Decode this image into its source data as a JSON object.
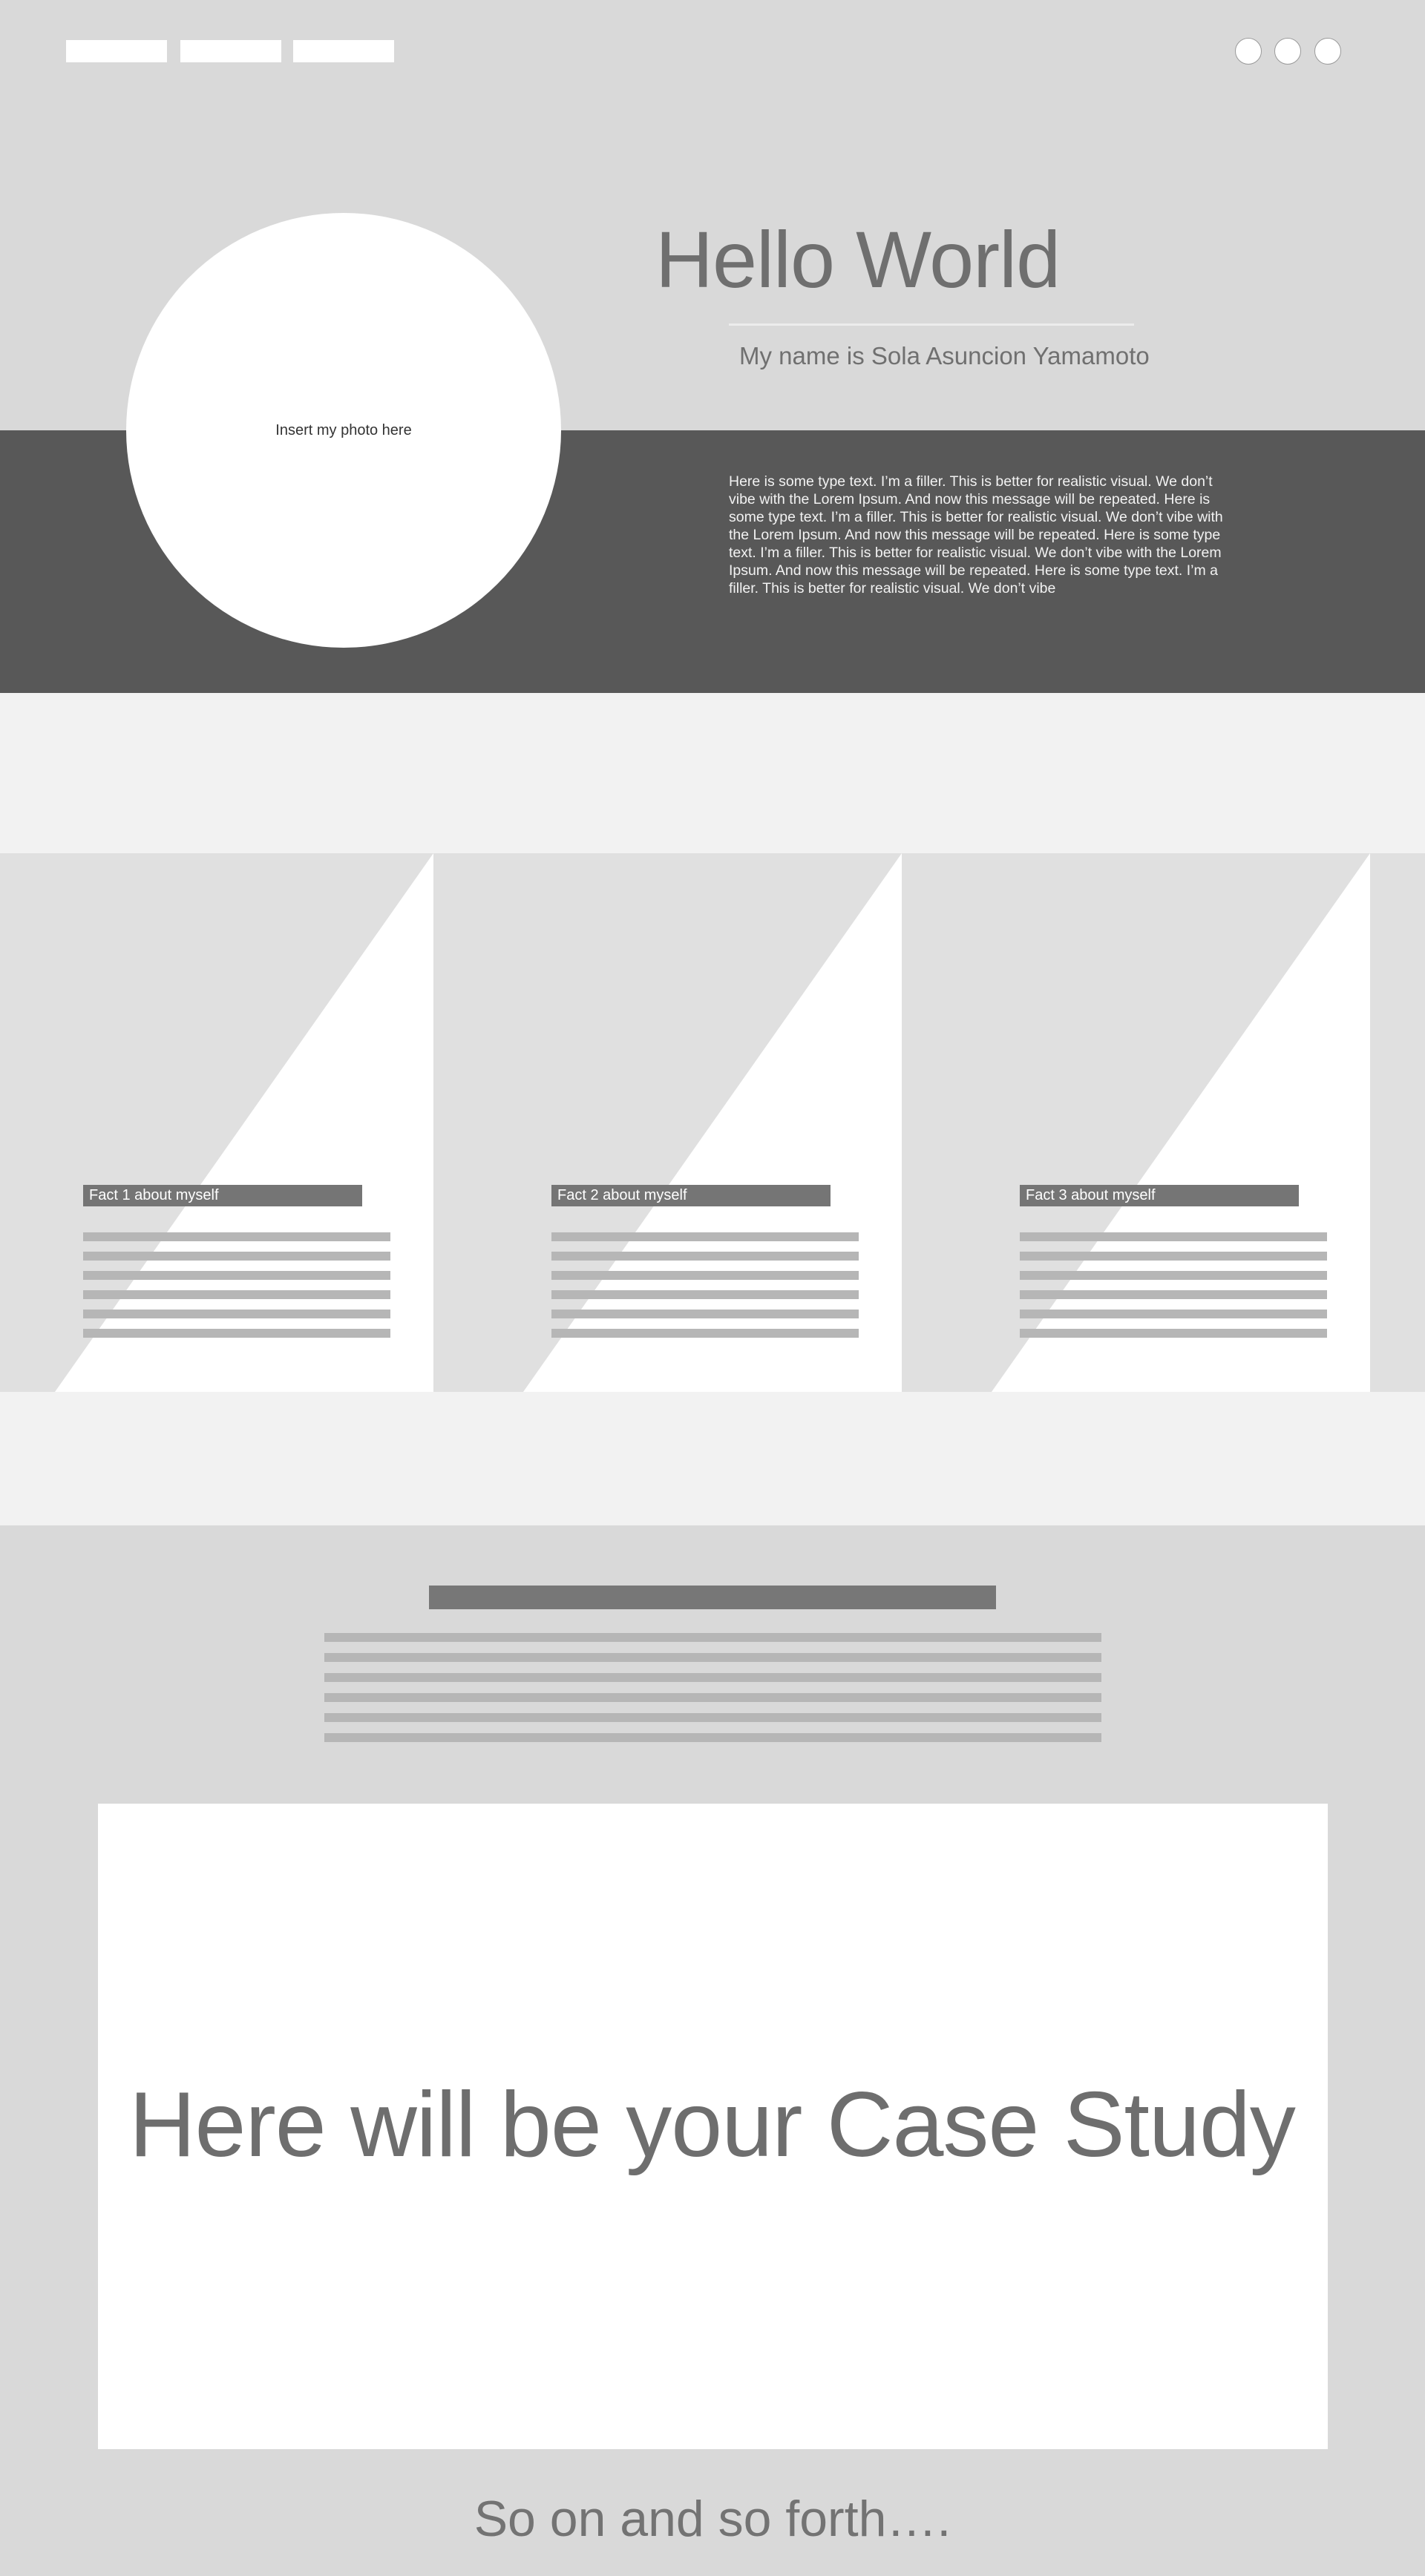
{
  "nav": {
    "items": [
      "",
      "",
      ""
    ],
    "social": [
      "",
      "",
      ""
    ]
  },
  "hero": {
    "photo_label": "Insert my photo here",
    "title": "Hello World",
    "subtitle": "My name is Sola Asuncion Yamamoto",
    "body": "Here is some type text. I’m a filler. This is better for realistic visual. We don’t vibe with the Lorem Ipsum. And now this message will be repeated. Here is some type text. I’m a filler. This is better for realistic visual. We don’t vibe with the Lorem Ipsum. And now this message will be repeated.  Here is some type text. I’m a filler. This is better for realistic visual. We don’t vibe with the Lorem Ipsum. And now this message will be repeated.  Here is some type text. I’m a filler. This is better for realistic visual. We don’t vibe"
  },
  "facts": [
    {
      "title": "Fact 1 about myself"
    },
    {
      "title": "Fact 2 about myself"
    },
    {
      "title": "Fact 3 about myself"
    }
  ],
  "case_study": {
    "title": "Here will be your Case Study"
  },
  "footer": {
    "text": "So on and so forth…."
  },
  "colors": {
    "page_bg": "#d9d9d9",
    "hero_dark": "#585858",
    "band_light": "#f2f2f2",
    "card_bg": "#e0e0e0",
    "accent_gray": "#757575",
    "placeholder_line": "#b6b6b6"
  }
}
